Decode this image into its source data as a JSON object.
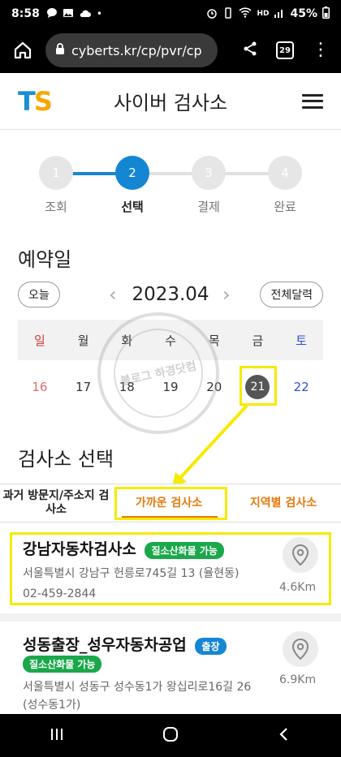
{
  "status": {
    "time": "8:58",
    "battery": "45%",
    "hd_label": "HD"
  },
  "browser": {
    "url": "cyberts.kr/cp/pvr/cp",
    "tab_count": "29"
  },
  "header": {
    "logo_t": "T",
    "logo_s": "S",
    "title": "사이버 검사소"
  },
  "stepper": {
    "steps": [
      {
        "num": "1",
        "label": "조회"
      },
      {
        "num": "2",
        "label": "선택"
      },
      {
        "num": "3",
        "label": "결제"
      },
      {
        "num": "4",
        "label": "완료"
      }
    ],
    "active_index": 1
  },
  "reservation": {
    "title": "예약일",
    "today_label": "오늘",
    "month": "2023.04",
    "full_calendar_label": "전체달력",
    "weekdays": [
      "일",
      "월",
      "화",
      "수",
      "목",
      "금",
      "토"
    ],
    "days": [
      "16",
      "17",
      "18",
      "19",
      "20",
      "21",
      "22"
    ],
    "selected_day": "21"
  },
  "watermark": {
    "text": "블로그 하경닷컴"
  },
  "center_section": {
    "title": "검사소 선택",
    "tabs": {
      "past": "과거 방문지/주소지 검사소",
      "near": "가까운 검사소",
      "region": "지역별 검사소"
    }
  },
  "centers": [
    {
      "name": "강남자동차검사소",
      "badges": [
        "질소산화물 가능"
      ],
      "address": "서울특별시 강남구 헌릉로745길 13 (율현동)",
      "phone": "02-459-2844",
      "distance": "4.6Km"
    },
    {
      "name": "성동출장_성우자동차공업",
      "badges": [
        "출장",
        "질소산화물 가능"
      ],
      "address": "서울특별시 성동구 성수동1가 왕십리로16길 26 (성수동1가)",
      "phone": "",
      "distance": "6.9Km"
    }
  ],
  "colors": {
    "primary_blue": "#1586d2",
    "accent_orange": "#e8780a",
    "badge_green": "#1aa84a",
    "highlight_yellow": "#f6ea00"
  }
}
